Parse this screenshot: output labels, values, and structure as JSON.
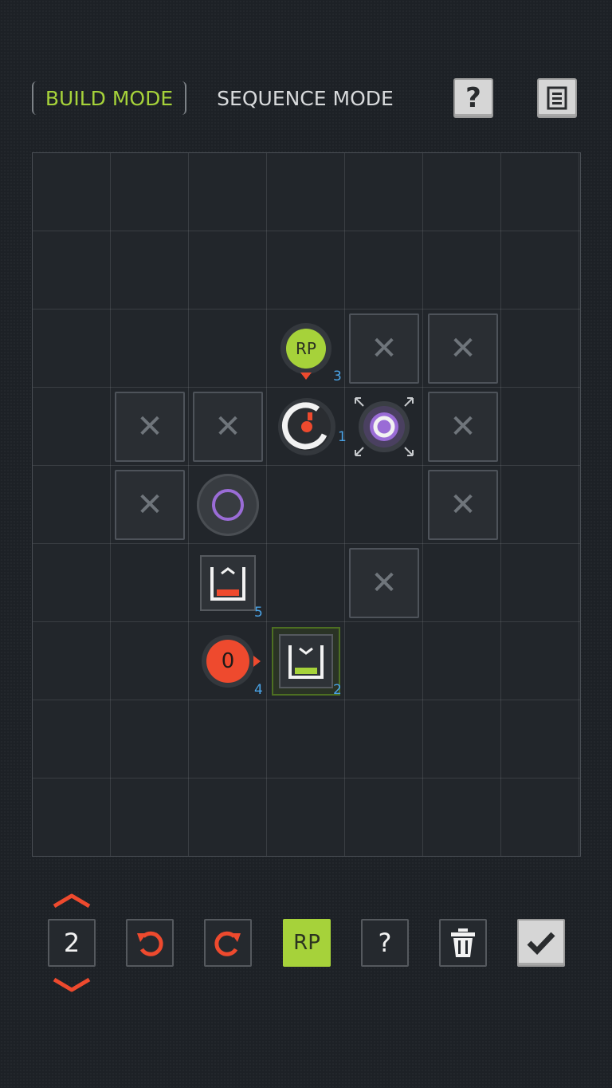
{
  "header": {
    "build_mode_label": "BUILD MODE",
    "sequence_mode_label": "SEQUENCE MODE",
    "help_label": "?",
    "menu_icon": "menu-icon"
  },
  "board": {
    "rows": 9,
    "cols": 7,
    "pieces": {
      "rp_label": "RP",
      "rp_number": "3",
      "rotator_number": "1",
      "bucket_top_number": "5",
      "zero_label": "0",
      "zero_number": "4",
      "bucket_selected_number": "2"
    }
  },
  "toolbar": {
    "level_value": "2",
    "rp_label": "RP",
    "help_label": "?",
    "colors": {
      "accent_green": "#a6d23a",
      "accent_red": "#ee4a2e",
      "purple": "#9a6cd6",
      "number_blue": "#4aa3e6"
    }
  }
}
